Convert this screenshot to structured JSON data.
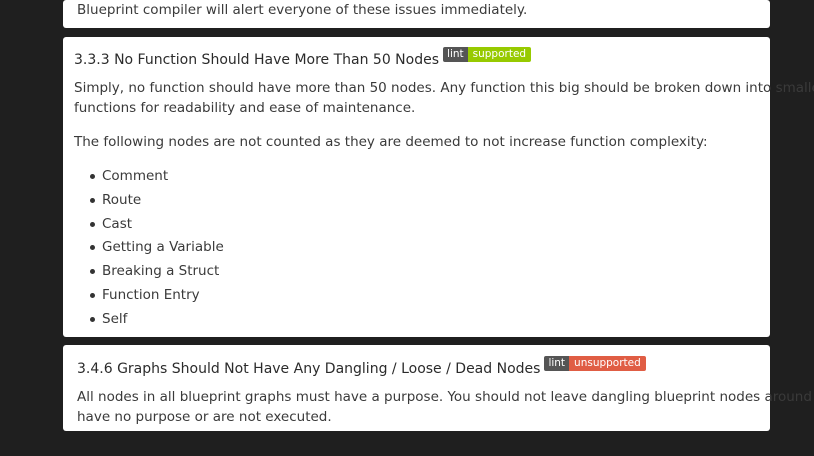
{
  "prev_section": {
    "trailing_text": "Blueprint compiler will alert everyone of these issues immediately."
  },
  "section_333": {
    "title": "3.3.3 No Function Should Have More Than 50 Nodes",
    "badge": {
      "left": "lint",
      "right": "supported",
      "color": "#97ca00"
    },
    "para1_line1": "Simply, no function should have more than 50 nodes. Any function this big should be broken down into smaller",
    "para1_line2": "functions for readability and ease of maintenance.",
    "para2": "The following nodes are not counted as they are deemed to not increase function complexity:",
    "items": [
      "Comment",
      "Route",
      "Cast",
      "Getting a Variable",
      "Breaking a Struct",
      "Function Entry",
      "Self"
    ]
  },
  "section_346": {
    "title": "3.4.6 Graphs Should Not Have Any Dangling / Loose / Dead Nodes",
    "badge": {
      "left": "lint",
      "right": "unsupported",
      "color": "#e05d44"
    },
    "para_line1": "All nodes in all blueprint graphs must have a purpose. You should not leave dangling blueprint nodes around that",
    "para_line2": "have no purpose or are not executed."
  }
}
